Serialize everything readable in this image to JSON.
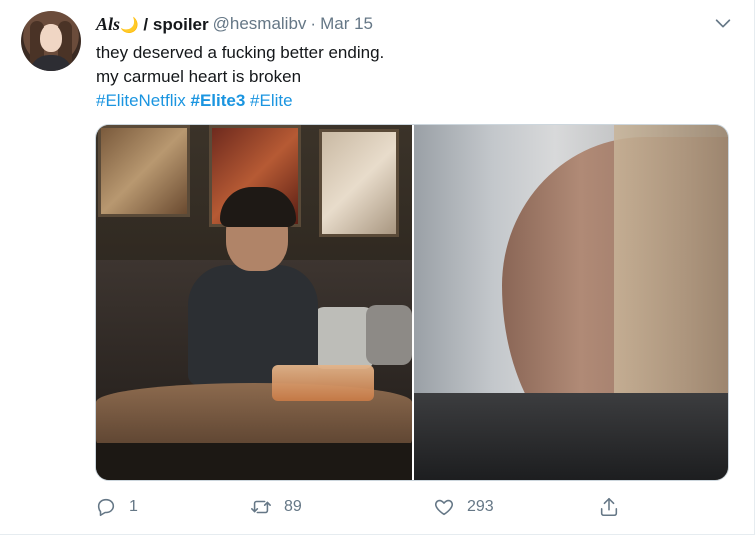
{
  "tweet": {
    "author": {
      "name_italic": "Als",
      "name_emoji": "🌙",
      "name_rest": " / spoiler",
      "handle": "@hesmalibv",
      "separator": "·",
      "date": "Mar 15"
    },
    "text_line1": "they deserved a fucking better ending.",
    "text_line2": "my carmuel heart is broken",
    "hashtags": [
      "#EliteNetflix",
      "#Elite3",
      "#Elite"
    ],
    "media_icons": [
      "photo-left",
      "photo-right"
    ],
    "actions": {
      "reply_count": "1",
      "retweet_count": "89",
      "like_count": "293"
    },
    "colors": {
      "accent": "#1b95e0",
      "muted": "#657786",
      "text": "#14171a"
    }
  }
}
